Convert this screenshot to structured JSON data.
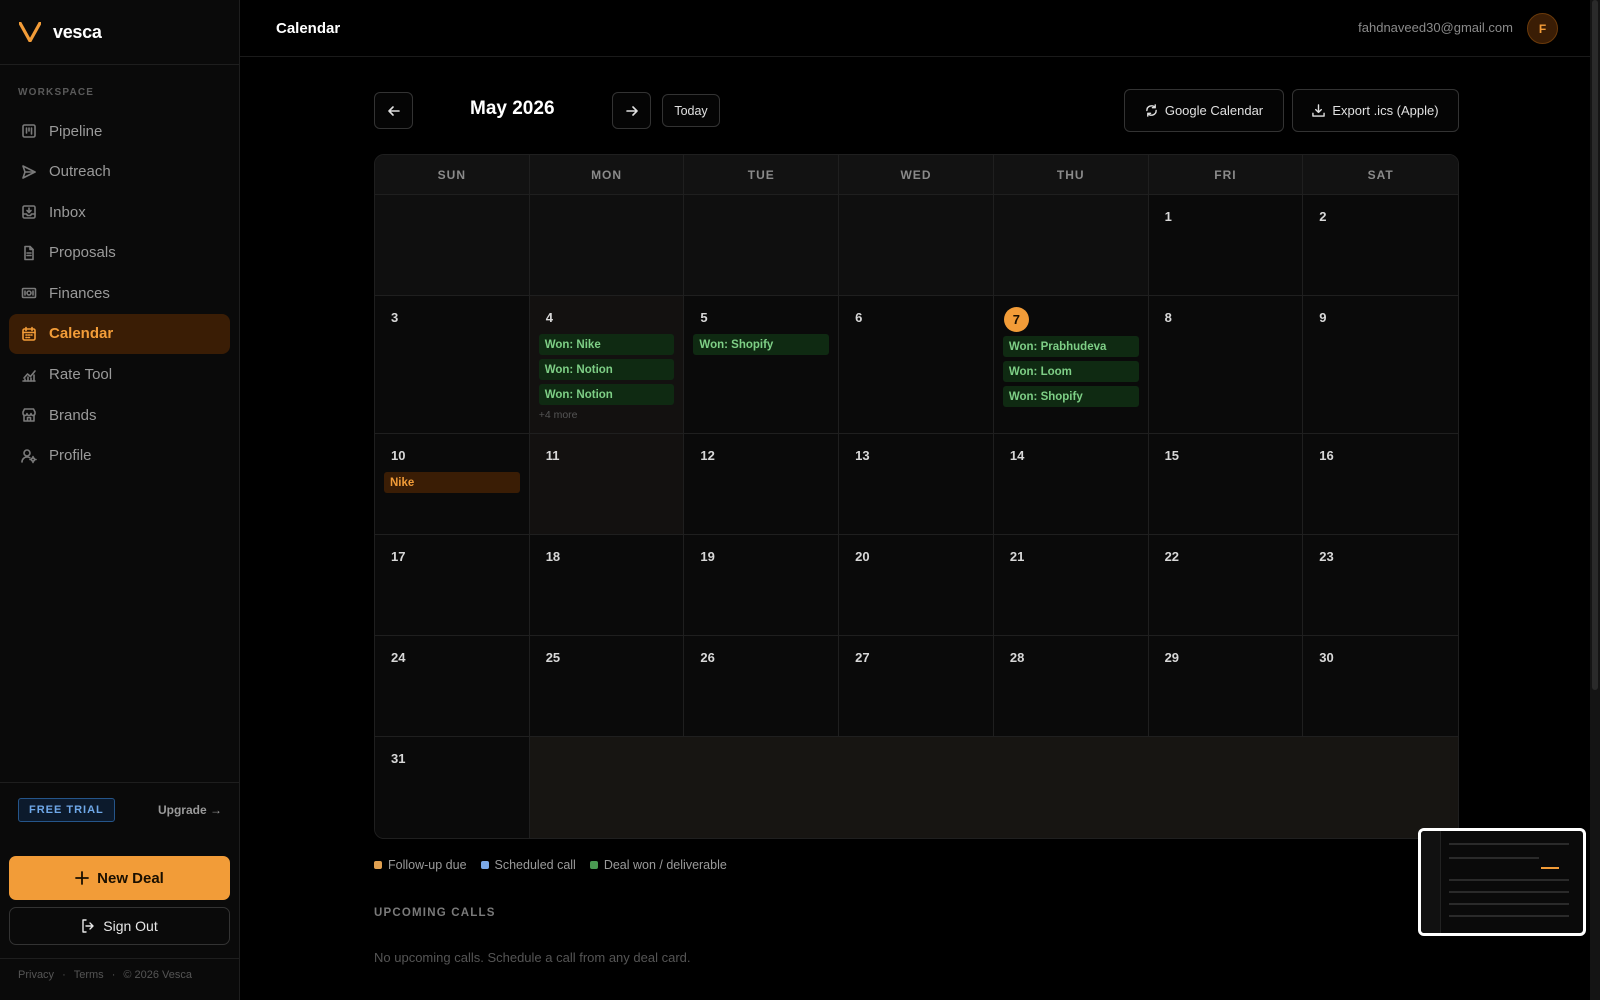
{
  "app": {
    "name": "vesca"
  },
  "sidebar": {
    "section_label": "WORKSPACE",
    "items": [
      {
        "label": "Pipeline",
        "icon": "kanban-icon",
        "active": false
      },
      {
        "label": "Outreach",
        "icon": "send-icon",
        "active": false
      },
      {
        "label": "Inbox",
        "icon": "inbox-icon",
        "active": false
      },
      {
        "label": "Proposals",
        "icon": "file-icon",
        "active": false
      },
      {
        "label": "Finances",
        "icon": "banknote-icon",
        "active": false
      },
      {
        "label": "Calendar",
        "icon": "calendar-icon",
        "active": true
      },
      {
        "label": "Rate Tool",
        "icon": "chart-icon",
        "active": false
      },
      {
        "label": "Brands",
        "icon": "store-icon",
        "active": false
      },
      {
        "label": "Profile",
        "icon": "user-gear-icon",
        "active": false
      }
    ],
    "trial_badge": "FREE TRIAL",
    "upgrade_label": "Upgrade →",
    "new_deal_label": "New Deal",
    "sign_out_label": "Sign Out",
    "footer": {
      "privacy": "Privacy",
      "terms": "Terms",
      "copyright": "© 2026 Vesca"
    }
  },
  "header": {
    "title": "Calendar",
    "user_email": "fahdnaveed30@gmail.com",
    "avatar_initial": "F"
  },
  "calendar": {
    "month_label": "May 2026",
    "today_label": "Today",
    "google_label": "Google Calendar",
    "export_label": "Export .ics (Apple)",
    "weekdays": [
      "SUN",
      "MON",
      "TUE",
      "WED",
      "THU",
      "FRI",
      "SAT"
    ],
    "today_date": 7,
    "weeks": [
      [
        null,
        null,
        null,
        null,
        null,
        {
          "day": "1"
        },
        {
          "day": "2"
        }
      ],
      [
        {
          "day": "3"
        },
        {
          "day": "4",
          "events": [
            {
              "label": "Won: Nike",
              "type": "won"
            },
            {
              "label": "Won: Notion",
              "type": "won"
            },
            {
              "label": "Won: Notion",
              "type": "won"
            }
          ],
          "more": "+4 more",
          "highlight": true
        },
        {
          "day": "5",
          "events": [
            {
              "label": "Won: Shopify",
              "type": "won"
            }
          ]
        },
        {
          "day": "6"
        },
        {
          "day": "7",
          "today": true,
          "events": [
            {
              "label": "Won: Prabhudeva",
              "type": "won"
            },
            {
              "label": "Won: Loom",
              "type": "won"
            },
            {
              "label": "Won: Shopify",
              "type": "won"
            }
          ]
        },
        {
          "day": "8"
        },
        {
          "day": "9"
        }
      ],
      [
        {
          "day": "10",
          "events": [
            {
              "label": "Nike",
              "type": "followup"
            }
          ]
        },
        {
          "day": "11",
          "highlight": true
        },
        {
          "day": "12"
        },
        {
          "day": "13"
        },
        {
          "day": "14"
        },
        {
          "day": "15"
        },
        {
          "day": "16"
        }
      ],
      [
        {
          "day": "17"
        },
        {
          "day": "18"
        },
        {
          "day": "19"
        },
        {
          "day": "20"
        },
        {
          "day": "21"
        },
        {
          "day": "22"
        },
        {
          "day": "23"
        }
      ],
      [
        {
          "day": "24"
        },
        {
          "day": "25"
        },
        {
          "day": "26"
        },
        {
          "day": "27"
        },
        {
          "day": "28"
        },
        {
          "day": "29"
        },
        {
          "day": "30"
        }
      ],
      [
        {
          "day": "31"
        },
        "filler",
        "filler",
        "filler",
        "filler",
        "filler",
        "filler"
      ]
    ]
  },
  "legend": [
    {
      "label": "Follow-up due",
      "color": "#e0a050"
    },
    {
      "label": "Scheduled call",
      "color": "#7aa8e8"
    },
    {
      "label": "Deal won / deliverable",
      "color": "#4a9a52"
    }
  ],
  "upcoming": {
    "title": "UPCOMING CALLS",
    "empty_text": "No upcoming calls. Schedule a call from any deal card."
  }
}
